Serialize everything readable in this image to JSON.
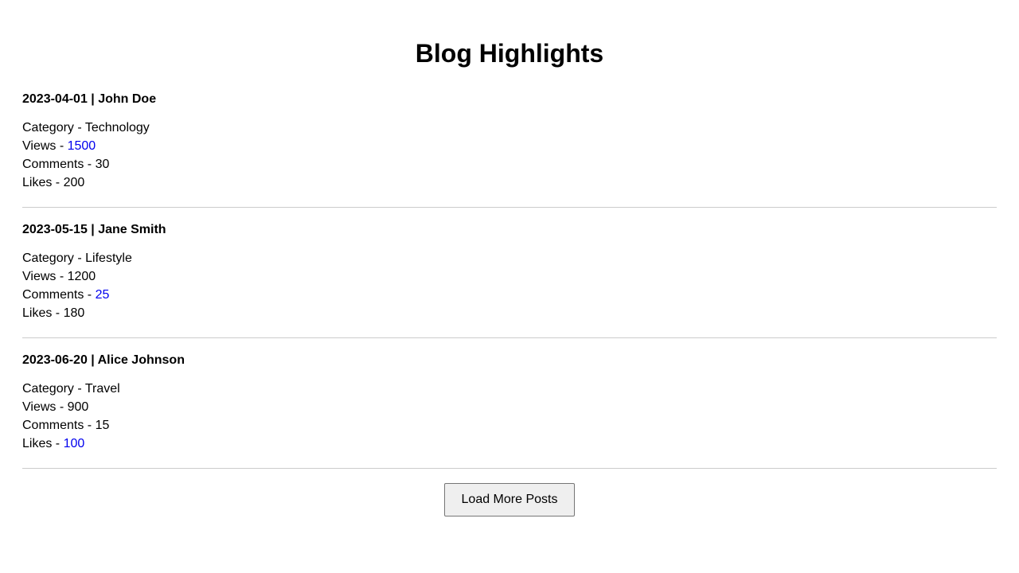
{
  "page": {
    "title": "Blog Highlights"
  },
  "posts": [
    {
      "meta": "2023-04-01 | John Doe",
      "category_label": "Category - ",
      "category": "Technology",
      "views_label": "Views - ",
      "views": "1500",
      "comments_label": "Comments - ",
      "comments": "30",
      "likes_label": "Likes - ",
      "likes": "200",
      "highlighted_stat": "views"
    },
    {
      "meta": "2023-05-15 | Jane Smith",
      "category_label": "Category - ",
      "category": "Lifestyle",
      "views_label": "Views - ",
      "views": "1200",
      "comments_label": "Comments - ",
      "comments": "25",
      "likes_label": "Likes - ",
      "likes": "180",
      "highlighted_stat": "comments"
    },
    {
      "meta": "2023-06-20 | Alice Johnson",
      "category_label": "Category - ",
      "category": "Travel",
      "views_label": "Views - ",
      "views": "900",
      "comments_label": "Comments - ",
      "comments": "15",
      "likes_label": "Likes - ",
      "likes": "100",
      "highlighted_stat": "likes"
    }
  ],
  "actions": {
    "load_more_label": "Load More Posts"
  },
  "colors": {
    "highlight": "#0000ee",
    "divider": "#cccccc",
    "button_bg": "#efefef"
  }
}
